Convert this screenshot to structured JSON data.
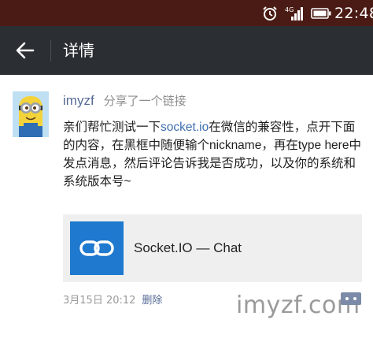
{
  "status_bar": {
    "network": "4G",
    "time": "22:48"
  },
  "title_bar": {
    "title": "详情"
  },
  "post": {
    "author": "imyzf",
    "share_note": "分享了一个链接",
    "text_before_link": "亲们帮忙测试一下",
    "link_text": "socket.io",
    "text_after_link": "在微信的兼容性，点开下面的内容，在黑框中随便输个nickname，再在type here中发点消息，然后评论告诉我是否成功，以及你的系统和系统版本号~",
    "link_card": {
      "title": "Socket.IO — Chat"
    },
    "time": "3月15日 20:12",
    "delete_label": "删除"
  },
  "watermark": {
    "text": "imyzf.com"
  },
  "colors": {
    "status_bar_bg": "#4a1b14",
    "title_bar_bg": "#2b2f33",
    "link_blue": "#576b95",
    "thumb_blue": "#1e79cf"
  }
}
